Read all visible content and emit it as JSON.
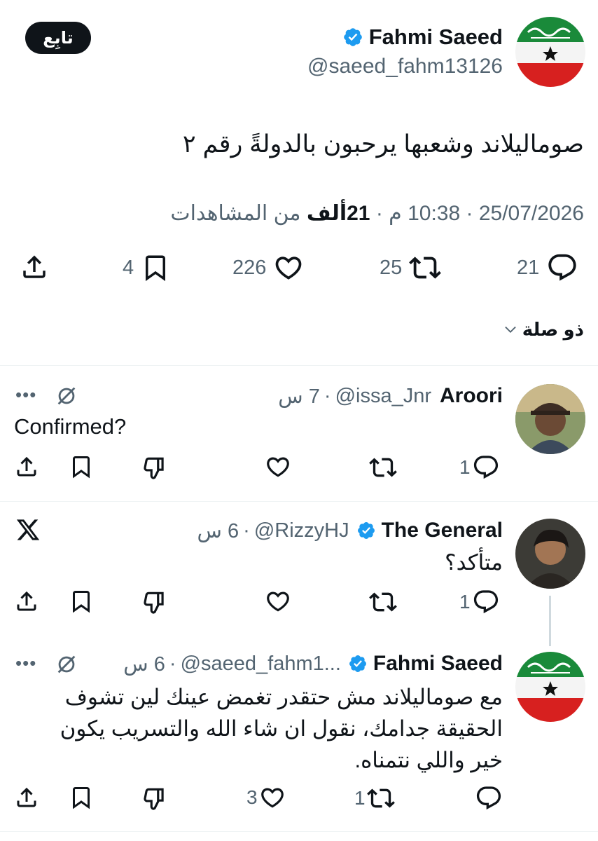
{
  "tweet": {
    "author_name": "Fahmi Saeed",
    "author_handle": "@saeed_fahm13126",
    "follow_label": "تابِع",
    "text": "صوماليلاند وشعبها يرحبون بالدولةً رقم ٢",
    "date": "25/07/2026",
    "time": "10:38 م",
    "views_number": "21",
    "views_unit": "ألف",
    "views_suffix": "من المشاهدات",
    "replies": "21",
    "retweets": "25",
    "likes": "226",
    "bookmarks": "4"
  },
  "relevance": {
    "label": "ذو صلة"
  },
  "replies": [
    {
      "name": "Aroori",
      "handle": "@issa_Jnr",
      "time": "7 س",
      "text": "Confirmed?",
      "replies": "1",
      "retweets": "",
      "likes": ""
    },
    {
      "name": "The General",
      "handle": "@RizzyHJ",
      "time": "6 س",
      "text": "متأكد؟",
      "replies": "1",
      "retweets": "",
      "likes": ""
    },
    {
      "name": "Fahmi Saeed",
      "handle": "@saeed_fahm1...",
      "time": "6 س",
      "text_line1": "مع صوماليلاند مش حتقدر تغمض عينك لين تشوف",
      "text_line2": "الحقيقة جدامك، نقول ان شاء الله والتسريب يكون",
      "text_line3": "خير واللي نتمناه.",
      "replies": "",
      "retweets": "1",
      "likes": "3"
    }
  ],
  "colors": {
    "text": "#0f1419",
    "secondary": "#536471",
    "verified": "#1d9bf0",
    "divider": "#eff3f4",
    "flag_green": "#1a8a3a",
    "flag_red": "#d7201f"
  }
}
